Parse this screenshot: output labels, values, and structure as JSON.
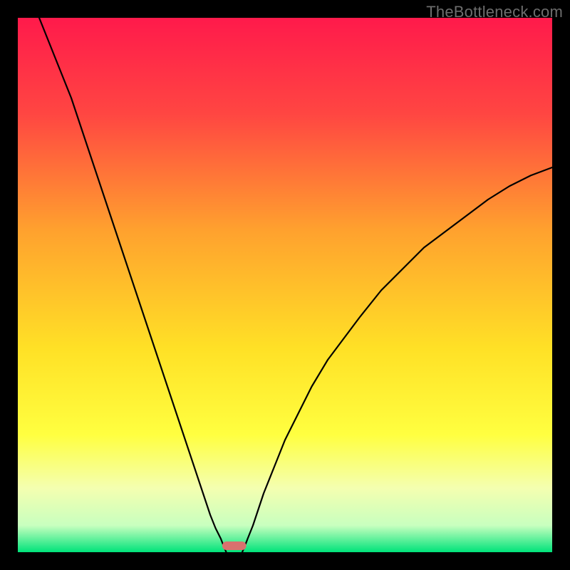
{
  "watermark": "TheBottleneck.com",
  "chart_data": {
    "type": "line",
    "title": "",
    "xlabel": "",
    "ylabel": "",
    "xlim": [
      0,
      100
    ],
    "ylim": [
      0,
      100
    ],
    "grid": false,
    "background_gradient": {
      "stops": [
        {
          "pos": 0.0,
          "color": "#ff1a4b"
        },
        {
          "pos": 0.18,
          "color": "#ff4642"
        },
        {
          "pos": 0.4,
          "color": "#ffa22e"
        },
        {
          "pos": 0.62,
          "color": "#ffe126"
        },
        {
          "pos": 0.78,
          "color": "#ffff40"
        },
        {
          "pos": 0.88,
          "color": "#f4ffb0"
        },
        {
          "pos": 0.95,
          "color": "#c8ffbf"
        },
        {
          "pos": 1.0,
          "color": "#00e37a"
        }
      ]
    },
    "series": [
      {
        "name": "left-branch",
        "x": [
          4,
          6,
          8,
          10,
          12,
          14,
          16,
          18,
          20,
          22,
          24,
          26,
          28,
          30,
          32,
          34,
          35,
          36,
          37,
          38,
          38.5,
          39
        ],
        "y": [
          100,
          95,
          90,
          85,
          79,
          73,
          67,
          61,
          55,
          49,
          43,
          37,
          31,
          25,
          19,
          13,
          10,
          7,
          4.5,
          2.5,
          1.2,
          0
        ]
      },
      {
        "name": "right-branch",
        "x": [
          42,
          42.5,
          43,
          44,
          45,
          46,
          48,
          50,
          52,
          55,
          58,
          61,
          64,
          68,
          72,
          76,
          80,
          84,
          88,
          92,
          96,
          100
        ],
        "y": [
          0,
          1.2,
          2.5,
          5,
          8,
          11,
          16,
          21,
          25,
          31,
          36,
          40,
          44,
          49,
          53,
          57,
          60,
          63,
          66,
          68.5,
          70.5,
          72
        ]
      }
    ],
    "marker": {
      "name": "bottleneck-marker",
      "x": 40.5,
      "y": 1.2,
      "width": 4.5,
      "height": 1.6,
      "color": "#d9716e"
    }
  }
}
